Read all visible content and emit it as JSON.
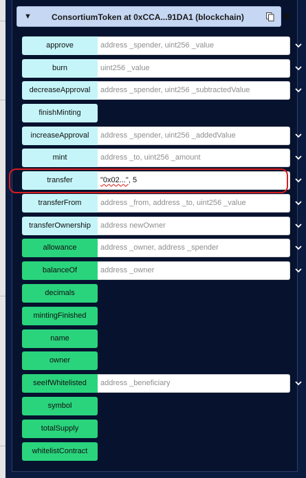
{
  "panel": {
    "title": "ConsortiumToken at 0xCCA...91DA1 (blockchain)",
    "caret": "▼",
    "close": "✖"
  },
  "functions": [
    {
      "name": "approve",
      "kind": "transact",
      "placeholder": "address _spender, uint256 _value"
    },
    {
      "name": "burn",
      "kind": "transact",
      "placeholder": "uint256 _value"
    },
    {
      "name": "decreaseApproval",
      "kind": "transact",
      "placeholder": "address _spender, uint256 _subtractedValue"
    },
    {
      "name": "finishMinting",
      "kind": "transact"
    },
    {
      "name": "increaseApproval",
      "kind": "transact",
      "placeholder": "address _spender, uint256 _addedValue"
    },
    {
      "name": "mint",
      "kind": "transact",
      "placeholder": "address _to, uint256 _amount"
    },
    {
      "name": "transfer",
      "kind": "transact",
      "value_quoted": "\"0x02...\"",
      "value_rest": ", 5"
    },
    {
      "name": "transferFrom",
      "kind": "transact",
      "placeholder": "address _from, address _to, uint256 _value"
    },
    {
      "name": "transferOwnership",
      "kind": "transact",
      "placeholder": "address newOwner"
    },
    {
      "name": "allowance",
      "kind": "call",
      "placeholder": "address _owner, address _spender"
    },
    {
      "name": "balanceOf",
      "kind": "call",
      "placeholder": "address _owner"
    },
    {
      "name": "decimals",
      "kind": "call"
    },
    {
      "name": "mintingFinished",
      "kind": "call"
    },
    {
      "name": "name",
      "kind": "call"
    },
    {
      "name": "owner",
      "kind": "call"
    },
    {
      "name": "seeIfWhitelisted",
      "kind": "call",
      "placeholder": "address _beneficiary"
    },
    {
      "name": "symbol",
      "kind": "call"
    },
    {
      "name": "totalSupply",
      "kind": "call"
    },
    {
      "name": "whitelistContract",
      "kind": "call"
    }
  ],
  "colors": {
    "transact_button": "#c5f5f8",
    "call_button": "#2ad47c",
    "highlight_outline": "#d61e1e",
    "panel_background": "#06122e"
  }
}
